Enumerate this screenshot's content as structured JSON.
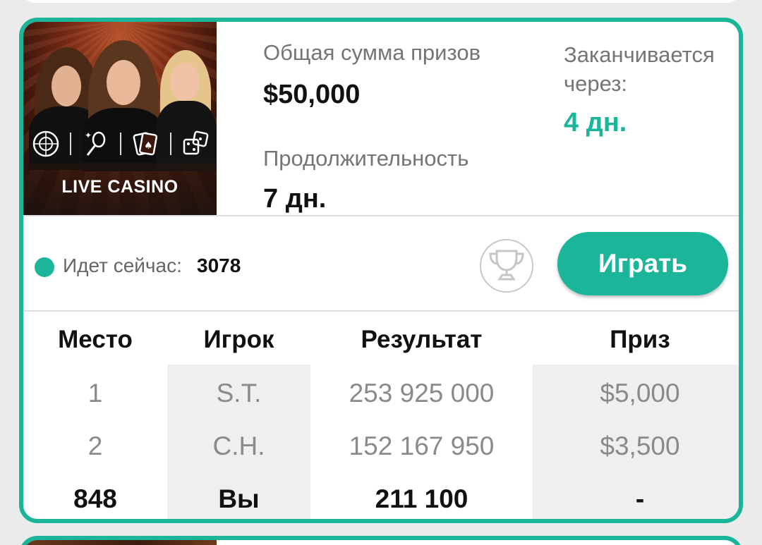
{
  "tournament": {
    "thumbnail_label": "LIVE CASINO",
    "prize_pool_label": "Общая сумма призов",
    "prize_pool_value": "$50,000",
    "duration_label": "Продолжительность",
    "duration_value": "7 дн.",
    "ends_label": "Заканчивается через:",
    "ends_value": "4 дн.",
    "accent_color": "#1bb59a"
  },
  "status": {
    "live_label": "Идет сейчас:",
    "live_count": "3078"
  },
  "actions": {
    "play_label": "Играть",
    "trophy_icon": "trophy-icon"
  },
  "leaderboard": {
    "headers": [
      "Место",
      "Игрок",
      "Результат",
      "Приз"
    ],
    "rows": [
      {
        "place": "1",
        "player": "S.T.",
        "result": "253 925 000",
        "prize": "$5,000"
      },
      {
        "place": "2",
        "player": "C.H.",
        "result": "152 167 950",
        "prize": "$3,500"
      },
      {
        "place": "848",
        "player": "Вы",
        "result": "211 100",
        "prize": "-"
      }
    ]
  }
}
